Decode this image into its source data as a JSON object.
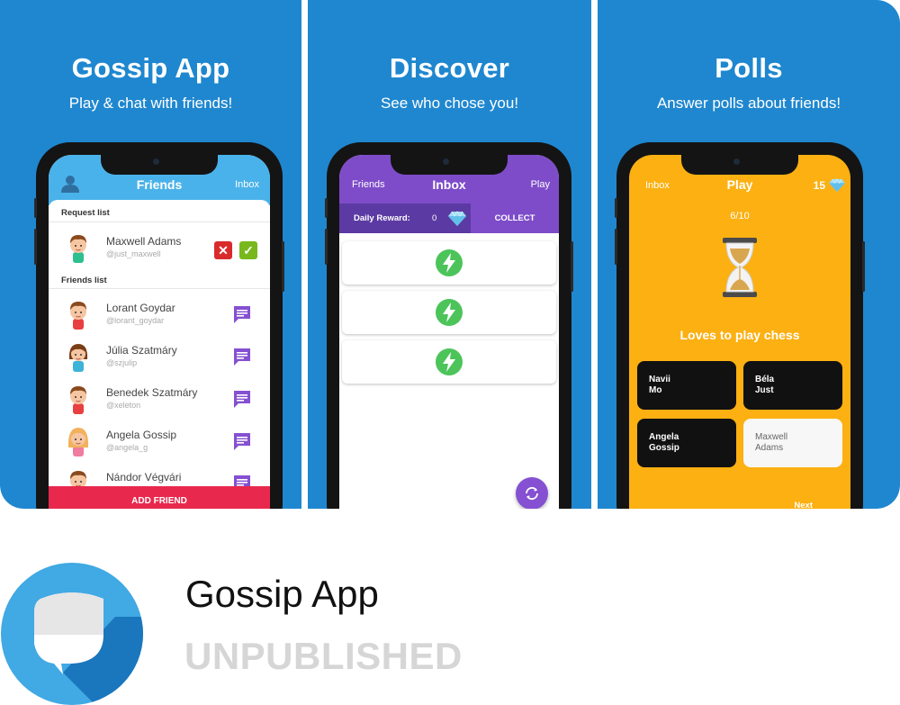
{
  "panels": [
    {
      "title": "Gossip App",
      "subtitle": "Play & chat with friends!"
    },
    {
      "title": "Discover",
      "subtitle": "See who chose you!"
    },
    {
      "title": "Polls",
      "subtitle": "Answer polls about friends!"
    }
  ],
  "friends_screen": {
    "title": "Friends",
    "inbox_label": "Inbox",
    "request_list_label": "Request list",
    "friends_list_label": "Friends list",
    "request": {
      "name": "Maxwell  Adams",
      "handle": "@just_maxwell"
    },
    "friends": [
      {
        "name": "Lorant  Goydar",
        "handle": "@lorant_goydar"
      },
      {
        "name": "Júlia  Szatmáry",
        "handle": "@szjulip"
      },
      {
        "name": "Benedek Szatmáry",
        "handle": "@xeleton"
      },
      {
        "name": "Angela  Gossip",
        "handle": "@angela_g"
      },
      {
        "name": "Nándor Végvári",
        "handle": ""
      }
    ],
    "add_friend_label": "ADD FRIEND"
  },
  "inbox_screen": {
    "left_label": "Friends",
    "title": "Inbox",
    "right_label": "Play",
    "daily_reward_label": "Daily Reward:",
    "daily_reward_value": "0",
    "collect_label": "COLLECT"
  },
  "play_screen": {
    "left_label": "Inbox",
    "title": "Play",
    "coins": "15",
    "progress": "6/10",
    "question": "Loves to play chess",
    "options": [
      {
        "line1": "Navii",
        "line2": "Mo"
      },
      {
        "line1": "Béla",
        "line2": "Just"
      },
      {
        "line1": "Angela",
        "line2": "Gossip"
      },
      {
        "line1": "Maxwell",
        "line2": "Adams"
      }
    ],
    "next_label": "Next"
  },
  "app": {
    "name": "Gossip App",
    "status": "UNPUBLISHED"
  },
  "colors": {
    "panel_blue": "#1f87cf",
    "friends_header": "#4ab2ea",
    "inbox_purple": "#7e4cc9",
    "play_orange": "#fcb012",
    "add_friend_red": "#e8294d"
  }
}
